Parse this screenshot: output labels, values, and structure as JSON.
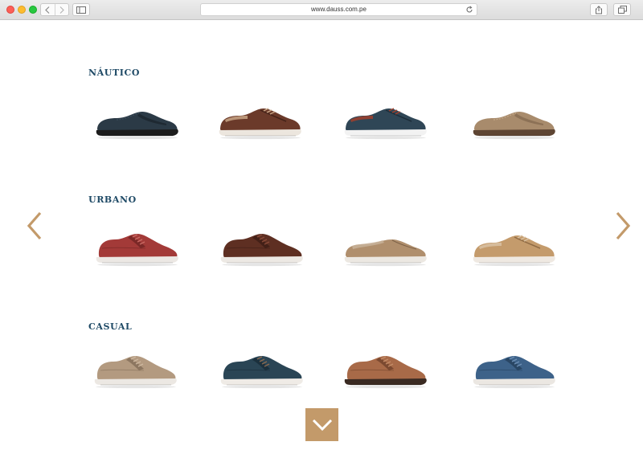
{
  "browser": {
    "url": "www.dauss.com.pe"
  },
  "categories": [
    {
      "title": "NÁUTICO",
      "products": [
        {
          "style": "loafer",
          "upper": "#2b3a46",
          "dark": "#161e25",
          "sole": "#1c1c1c",
          "accent": "#3b4d5c"
        },
        {
          "style": "boat",
          "upper": "#6b3a2a",
          "dark": "#442218",
          "sole": "#ece6de",
          "accent": "#c8a686"
        },
        {
          "style": "boat",
          "upper": "#2f4656",
          "dark": "#1c2c38",
          "sole": "#f2f2f2",
          "accent": "#a0402c"
        },
        {
          "style": "loafer",
          "upper": "#a88b6c",
          "dark": "#7a6048",
          "sole": "#5e4533",
          "accent": "#c4a888"
        }
      ]
    },
    {
      "title": "URBANO",
      "products": [
        {
          "style": "derby",
          "upper": "#a33a38",
          "dark": "#6e2322",
          "sole": "#ece8e4",
          "accent": "#c96a64"
        },
        {
          "style": "derby",
          "upper": "#5e2f22",
          "dark": "#3b1c14",
          "sole": "#ede9e4",
          "accent": "#8a4b38"
        },
        {
          "style": "slipon",
          "upper": "#b08f6d",
          "dark": "#7e6248",
          "sole": "#ece8e2",
          "accent": "#c9b49c"
        },
        {
          "style": "boat",
          "upper": "#c49b6c",
          "dark": "#8e6a44",
          "sole": "#efe9e2",
          "accent": "#d9c2a4"
        }
      ]
    },
    {
      "title": "CASUAL",
      "products": [
        {
          "style": "derby",
          "upper": "#b39a80",
          "dark": "#7f6a55",
          "sole": "#ece8e3",
          "accent": "#cdb79f"
        },
        {
          "style": "derby",
          "upper": "#2a4555",
          "dark": "#172a35",
          "sole": "#efebe6",
          "accent": "#8a6a50"
        },
        {
          "style": "derby",
          "upper": "#a86a48",
          "dark": "#6c3f28",
          "sole": "#3a2a22",
          "accent": "#c48c68"
        },
        {
          "style": "derby",
          "upper": "#3d6289",
          "dark": "#233d58",
          "sole": "#ebe7e2",
          "accent": "#6d8fb4"
        }
      ]
    }
  ],
  "accent_color": "#c39a6a",
  "title_color": "#1f4a66",
  "icons": {
    "prev": "chevron-left-icon",
    "next": "chevron-right-icon",
    "down": "chevron-down-icon"
  }
}
